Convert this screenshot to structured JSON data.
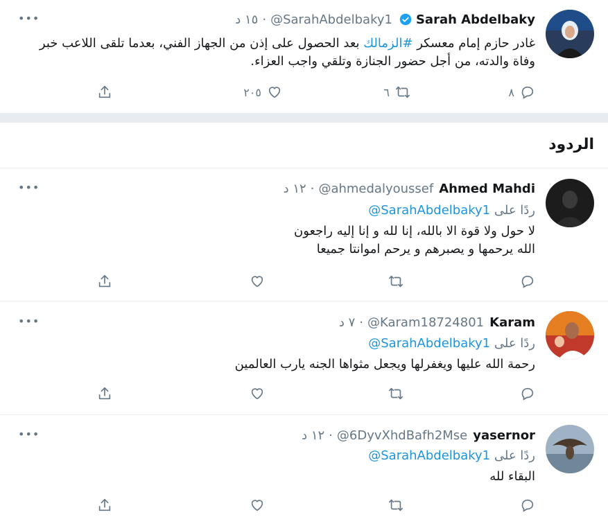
{
  "main_tweet": {
    "name": "Sarah Abdelbaky",
    "handle": "@SarahAbdelbaky1",
    "time": "١٥ د",
    "text_before": "غادر حازم إمام معسكر ",
    "hashtag": "#الزمالك",
    "text_after": " بعد الحصول على إذن من الجهاز الفني، بعدما تلقى اللاعب خبر وفاة والدته، من أجل حضور الجنازة وتلقي واجب العزاء.",
    "replies": "٨",
    "retweets": "٦",
    "likes": "٢٠٥",
    "more": "•••"
  },
  "replies_header": "الردود",
  "reply_prefix": "ردًا على",
  "reply_to_handle": "@SarahAbdelbaky1",
  "replies": [
    {
      "name": "Ahmed Mahdi",
      "handle": "@ahmedalyoussef",
      "time": "١٢ د",
      "line1": "لا حول ولا قوة الا بالله، إنا لله و إنا إليه راجعون",
      "line2": "الله يرحمها و يصبرهم و يرحم اموانتا جميعا",
      "more": "•••"
    },
    {
      "name": "Karam",
      "handle": "@Karam18724801",
      "time": "٧ د",
      "line1": "رحمة الله عليها ويغفرلها ويجعل مثواها الجنه يارب العالمين",
      "more": "•••"
    },
    {
      "name": "yasernor",
      "handle": "@6DyvXhdBafh2Mse",
      "time": "١٢ د",
      "line1": "البقاء لله",
      "more": "•••"
    }
  ],
  "colors": {
    "link": "#1b95e0",
    "muted": "#657786",
    "divider": "#e6ecf0",
    "verified": "#1da1f2"
  },
  "icons": [
    "reply-icon",
    "retweet-icon",
    "like-icon",
    "share-icon",
    "verified-icon",
    "more-icon"
  ]
}
